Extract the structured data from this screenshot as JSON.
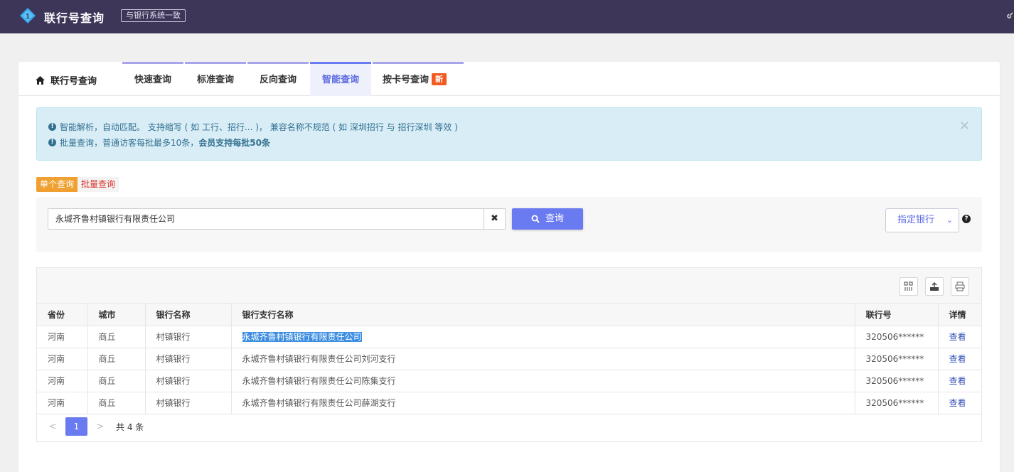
{
  "header": {
    "app_title": "联行号查询",
    "badge": "与银行系统一致"
  },
  "tabs": {
    "home_label": "联行号查询",
    "items": [
      {
        "label": "快速查询"
      },
      {
        "label": "标准查询"
      },
      {
        "label": "反向查询"
      },
      {
        "label": "智能查询",
        "active": true
      },
      {
        "label": "按卡号查询",
        "tag": "新"
      }
    ]
  },
  "alert": {
    "line1": "智能解析，自动匹配。 支持缩写 ( 如 工行、招行... )， 兼容名称不规范 ( 如 深圳招行 与 招行深圳 等效 )",
    "line2_prefix": "批量查询，普通访客每批最多10条，",
    "line2_bold": "会员支持每批50条",
    "close": "×"
  },
  "modes": {
    "single": "单个查询",
    "batch": "批量查询"
  },
  "search": {
    "value": "永城齐鲁村镇银行有限责任公司",
    "clear": "✖",
    "button": "查询",
    "bank_select": "指定银行",
    "help": "?"
  },
  "table": {
    "headers": [
      "省份",
      "城市",
      "银行名称",
      "银行支行名称",
      "联行号",
      "详情"
    ],
    "rows": [
      [
        "河南",
        "商丘",
        "村镇银行",
        "永城齐鲁村镇银行有限责任公司",
        "320506******",
        "查看"
      ],
      [
        "河南",
        "商丘",
        "村镇银行",
        "永城齐鲁村镇银行有限责任公司刘河支行",
        "320506******",
        "查看"
      ],
      [
        "河南",
        "商丘",
        "村镇银行",
        "永城齐鲁村镇银行有限责任公司陈集支行",
        "320506******",
        "查看"
      ],
      [
        "河南",
        "商丘",
        "村镇银行",
        "永城齐鲁村镇银行有限责任公司薛湖支行",
        "320506******",
        "查看"
      ]
    ]
  },
  "pager": {
    "prev": "<",
    "current": "1",
    "next": ">",
    "total": "共 4 条"
  },
  "colors": {
    "topbar": "#3e3659",
    "accent": "#6a7af0",
    "info_bg": "#d9edf7",
    "new_tag": "#f25a22",
    "single_mode": "#f0a030"
  }
}
